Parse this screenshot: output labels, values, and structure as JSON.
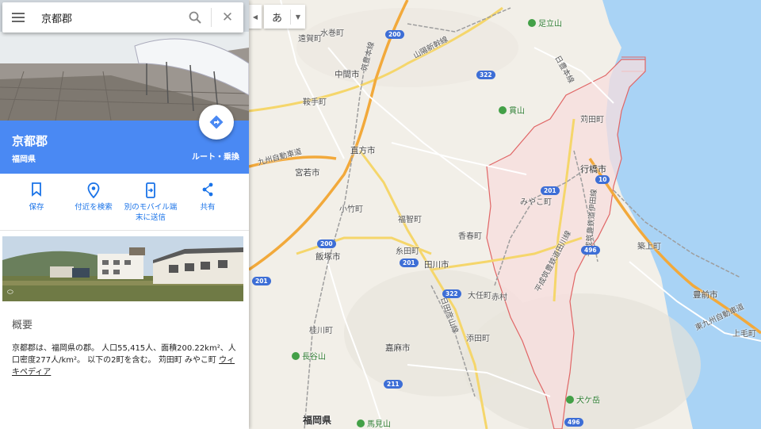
{
  "search": {
    "query": "京都郡"
  },
  "place": {
    "title": "京都郡",
    "subtitle": "福岡県",
    "route_label": "ルート・乗換"
  },
  "actions": [
    {
      "label": "保存",
      "icon": "bookmark-icon"
    },
    {
      "label": "付近を検索",
      "icon": "location-pin-icon"
    },
    {
      "label": "別のモバイル端末に送信",
      "icon": "send-to-phone-icon"
    },
    {
      "label": "共有",
      "icon": "share-icon"
    }
  ],
  "about": {
    "heading": "概要",
    "text": "京都郡は、福岡県の郡。 人口55,415人、面積200.22km²、人口密度277人/km²。 以下の2町を含む。 苅田町 みやこ町 ",
    "link": "ウィキペディア"
  },
  "language_picker": {
    "value": "あ"
  },
  "colors": {
    "accent": "#4a89f3",
    "boundary": "#e06666",
    "boundary_fill": "#f7dede",
    "sea": "#a9d3f5"
  },
  "map": {
    "places": [
      "足立山",
      "遠賀町",
      "水巻町",
      "中間市",
      "鞍手町",
      "直方市",
      "宮若市",
      "小竹町",
      "福智町",
      "香春町",
      "飯塚市",
      "糸田町",
      "田川市",
      "大任町",
      "赤村",
      "桂川町",
      "添田町",
      "嘉麻市",
      "長谷山",
      "福岡県",
      "馬見山",
      "貫山",
      "苅田町",
      "行橋市",
      "みやこ町",
      "築上町",
      "豊前市",
      "上毛町",
      "犬ケ岳"
    ],
    "railways": [
      "筑豊本線",
      "山陽新幹線",
      "日豊本線",
      "平成筑豊鉄道伊田線",
      "平成筑豊鉄道田川線",
      "日田彦山線",
      "東九州自動車道",
      "九州自動車道"
    ],
    "route_numbers": [
      "200",
      "322",
      "201",
      "10",
      "496",
      "211"
    ]
  }
}
